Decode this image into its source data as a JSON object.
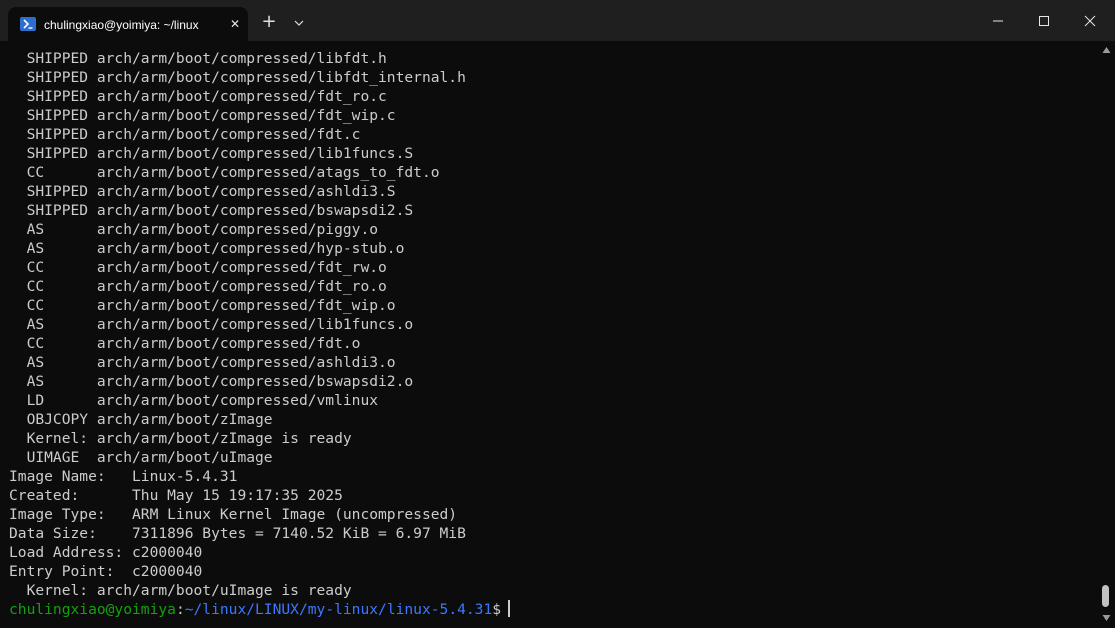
{
  "window": {
    "tab_title": "chulingxiao@yoimiya: ~/linux",
    "tab_icon": "powershell-icon",
    "close_tab_glyph": "✕",
    "new_tab_glyph": "+",
    "accent": "#2d6fd1"
  },
  "terminal": {
    "colors": {
      "background": "#0c0c0c",
      "foreground": "#cccccc",
      "prompt_user": "#13a10e",
      "prompt_path": "#3b78ff"
    },
    "lines": [
      "  SHIPPED arch/arm/boot/compressed/libfdt.h",
      "  SHIPPED arch/arm/boot/compressed/libfdt_internal.h",
      "  SHIPPED arch/arm/boot/compressed/fdt_ro.c",
      "  SHIPPED arch/arm/boot/compressed/fdt_wip.c",
      "  SHIPPED arch/arm/boot/compressed/fdt.c",
      "  SHIPPED arch/arm/boot/compressed/lib1funcs.S",
      "  CC      arch/arm/boot/compressed/atags_to_fdt.o",
      "  SHIPPED arch/arm/boot/compressed/ashldi3.S",
      "  SHIPPED arch/arm/boot/compressed/bswapsdi2.S",
      "  AS      arch/arm/boot/compressed/piggy.o",
      "  AS      arch/arm/boot/compressed/hyp-stub.o",
      "  CC      arch/arm/boot/compressed/fdt_rw.o",
      "  CC      arch/arm/boot/compressed/fdt_ro.o",
      "  CC      arch/arm/boot/compressed/fdt_wip.o",
      "  AS      arch/arm/boot/compressed/lib1funcs.o",
      "  CC      arch/arm/boot/compressed/fdt.o",
      "  AS      arch/arm/boot/compressed/ashldi3.o",
      "  AS      arch/arm/boot/compressed/bswapsdi2.o",
      "  LD      arch/arm/boot/compressed/vmlinux",
      "  OBJCOPY arch/arm/boot/zImage",
      "  Kernel: arch/arm/boot/zImage is ready",
      "  UIMAGE  arch/arm/boot/uImage",
      "Image Name:   Linux-5.4.31",
      "Created:      Thu May 15 19:17:35 2025",
      "Image Type:   ARM Linux Kernel Image (uncompressed)",
      "Data Size:    7311896 Bytes = 7140.52 KiB = 6.97 MiB",
      "Load Address: c2000040",
      "Entry Point:  c2000040",
      "  Kernel: arch/arm/boot/uImage is ready"
    ],
    "prompt": {
      "user_host": "chulingxiao@yoimiya",
      "separator": ":",
      "path": "~/linux/LINUX/my-linux/linux-5.4.31",
      "symbol": "$"
    }
  }
}
